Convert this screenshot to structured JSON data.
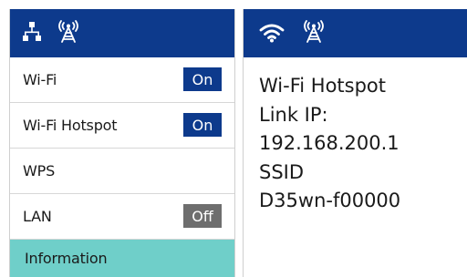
{
  "left_panel": {
    "header_icons": [
      "network-icon",
      "antenna-icon"
    ],
    "items": [
      {
        "label": "Wi-Fi",
        "toggle": "On"
      },
      {
        "label": "Wi-Fi Hotspot",
        "toggle": "On"
      },
      {
        "label": "WPS"
      },
      {
        "label": "LAN",
        "toggle": "Off"
      },
      {
        "label": "Information",
        "selected": true
      }
    ]
  },
  "right_panel": {
    "header_icons": [
      "wifi-icon",
      "antenna-icon"
    ],
    "info_lines": [
      "Wi-Fi Hotspot",
      "Link IP:",
      "192.168.200.1",
      "SSID",
      "D35wn-f00000"
    ]
  },
  "colors": {
    "header": "#0d3a8c",
    "toggle_on": "#0d3a8c",
    "toggle_off": "#6e6e6e",
    "selected_item": "#6fcfc9"
  }
}
